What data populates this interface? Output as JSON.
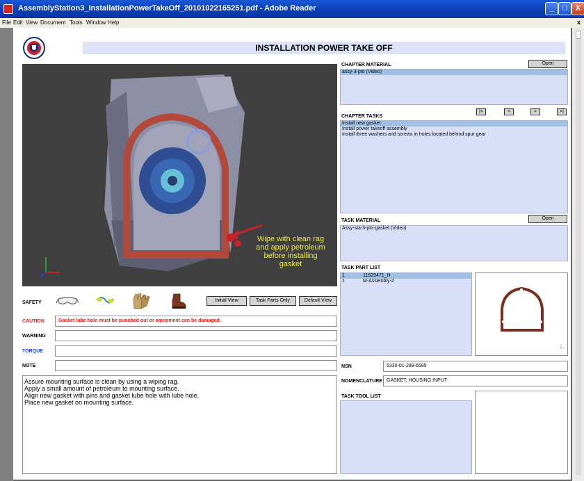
{
  "window": {
    "title": "AssemblyStation3_InstallationPowerTakeOff_20101022165251.pdf - Adobe Reader",
    "minimize": "_",
    "maximize": "□",
    "close": "X"
  },
  "menu": [
    "File",
    "Edit",
    "View",
    "Document",
    "Tools",
    "Window",
    "Help"
  ],
  "menu_close": "x",
  "page_title": "INSTALLATION POWER TAKE OFF",
  "callout": [
    "Wipe with clean rag",
    "and apply petroleum",
    "before installing gasket"
  ],
  "safety": {
    "label": "SAFETY",
    "icons": [
      "safety-goggles-icon",
      "earplugs-icon",
      "work-gloves-icon",
      "safety-boot-icon"
    ]
  },
  "view_buttons": [
    "Initial View",
    "Task Parts Only",
    "Default View"
  ],
  "caution": {
    "label": "CAUTION",
    "value": "Gasket lube hole must be punched out or equipment can be damaged."
  },
  "warning": {
    "label": "WARNING",
    "value": ""
  },
  "torque": {
    "label": "TORQUE",
    "value": ""
  },
  "note": {
    "label": "NOTE",
    "value": ""
  },
  "steps": [
    "Assure mounting surface is clean by using a wiping rag.",
    "Apply a small amount of petroleum to mounting surface.",
    "Align new gasket with pins and gasket lube hole with lube hole.",
    "Place new gasket on mounting surface."
  ],
  "chapter_material": {
    "label": "CHAPTER MATERIAL",
    "open": "Open",
    "items": [
      "assy-3-pto  (Video)"
    ]
  },
  "chapter_tasks": {
    "label": "CHAPTER TASKS",
    "nav": [
      "|<",
      "<",
      ">",
      ">|"
    ],
    "items": [
      "Install new gasket",
      "Install power takeoff assembly",
      "Install three washers and screws in holes located behind spur gear"
    ]
  },
  "task_material": {
    "label": "TASK MATERIAL",
    "open": "Open",
    "items": [
      "Assy-sta-3-pto-gasket  (Video)"
    ]
  },
  "task_part_list": {
    "label": "TASK PART LIST",
    "rows": [
      {
        "qty": "1",
        "part": "11629471_H"
      },
      {
        "qty": "1",
        "part": "M-Assembly-2"
      }
    ]
  },
  "nsn": {
    "label": "NSN",
    "value": "5330-01-289-6585"
  },
  "nomenclature": {
    "label": "NOMENCLATURE",
    "value": "GASKET, HOUSING INPUT"
  },
  "task_tool_list": {
    "label": "TASK TOOL LIST"
  },
  "colors": {
    "caution": "#e8201a",
    "torque": "#1a3fd6",
    "panel": "#d8e0f8",
    "selected": "#9fc0e5",
    "callout": "#f0e63c"
  }
}
